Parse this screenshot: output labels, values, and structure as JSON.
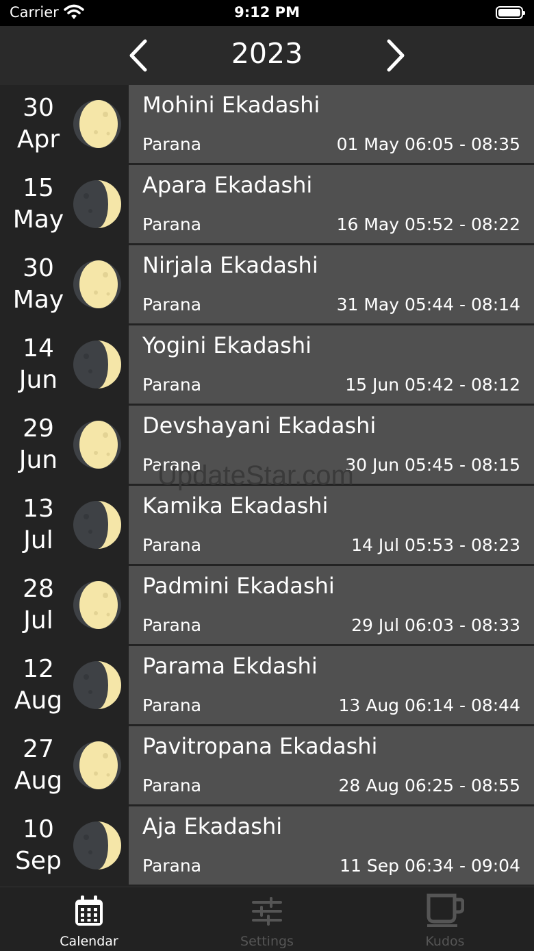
{
  "status": {
    "carrier": "Carrier",
    "time": "9:12 PM"
  },
  "header": {
    "year": "2023"
  },
  "events": [
    {
      "day": "30",
      "month": "Apr",
      "phase": "full",
      "name": "Mohini Ekadashi",
      "parana_label": "Parana",
      "parana_time": "01 May 06:05 - 08:35"
    },
    {
      "day": "15",
      "month": "May",
      "phase": "crescent",
      "name": "Apara Ekadashi",
      "parana_label": "Parana",
      "parana_time": "16 May 05:52 - 08:22"
    },
    {
      "day": "30",
      "month": "May",
      "phase": "full",
      "name": "Nirjala Ekadashi",
      "parana_label": "Parana",
      "parana_time": "31 May 05:44 - 08:14"
    },
    {
      "day": "14",
      "month": "Jun",
      "phase": "crescent",
      "name": "Yogini Ekadashi",
      "parana_label": "Parana",
      "parana_time": "15 Jun 05:42 - 08:12"
    },
    {
      "day": "29",
      "month": "Jun",
      "phase": "full",
      "name": "Devshayani Ekadashi",
      "parana_label": "Parana",
      "parana_time": "30 Jun 05:45 - 08:15"
    },
    {
      "day": "13",
      "month": "Jul",
      "phase": "crescent",
      "name": "Kamika Ekadashi",
      "parana_label": "Parana",
      "parana_time": "14 Jul 05:53 - 08:23"
    },
    {
      "day": "28",
      "month": "Jul",
      "phase": "full",
      "name": "Padmini Ekadashi",
      "parana_label": "Parana",
      "parana_time": "29 Jul 06:03 - 08:33"
    },
    {
      "day": "12",
      "month": "Aug",
      "phase": "crescent",
      "name": "Parama Ekdashi",
      "parana_label": "Parana",
      "parana_time": "13 Aug 06:14 - 08:44"
    },
    {
      "day": "27",
      "month": "Aug",
      "phase": "full",
      "name": "Pavitropana Ekadashi",
      "parana_label": "Parana",
      "parana_time": "28 Aug 06:25 - 08:55"
    },
    {
      "day": "10",
      "month": "Sep",
      "phase": "crescent",
      "name": "Aja Ekadashi",
      "parana_label": "Parana",
      "parana_time": "11 Sep 06:34 - 09:04"
    }
  ],
  "watermark": "UpdateStar.com",
  "tabs": [
    {
      "label": "Calendar",
      "icon": "calendar-icon",
      "active": true
    },
    {
      "label": "Settings",
      "icon": "sliders-icon",
      "active": false
    },
    {
      "label": "Kudos",
      "icon": "coffee-cup-icon",
      "active": false
    }
  ],
  "colors": {
    "background": "#232323",
    "row": "#505050",
    "moon": "#F5E6A8",
    "moon_dark": "#3E4145"
  }
}
